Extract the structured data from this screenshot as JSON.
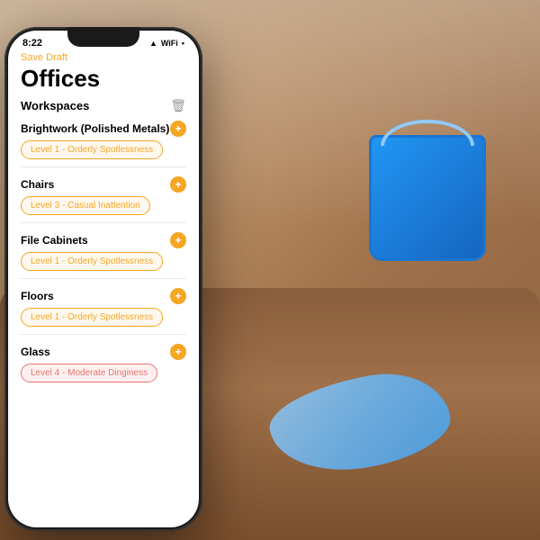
{
  "phone": {
    "status_bar": {
      "time": "8:22",
      "signal": "▲",
      "wifi": "WiFi",
      "battery": "🔋"
    },
    "save_draft": "Save Draft",
    "page_title": "Offices",
    "section": {
      "label": "Workspaces",
      "delete_icon": "🗑"
    },
    "workspaces": [
      {
        "name": "Brightwork (Polished Metals)",
        "level": "Level 1 - Orderly Spotlessness",
        "level_type": "orange"
      },
      {
        "name": "Chairs",
        "level": "Level 3 - Casual Inattention",
        "level_type": "orange"
      },
      {
        "name": "File Cabinets",
        "level": "Level 1 - Orderly Spotlessness",
        "level_type": "orange"
      },
      {
        "name": "Floors",
        "level": "Level 1 - Orderly Spotlessness",
        "level_type": "orange"
      },
      {
        "name": "Glass",
        "level": "Level 4 - Moderate Dinginess",
        "level_type": "pink"
      }
    ],
    "add_icon": "+"
  }
}
